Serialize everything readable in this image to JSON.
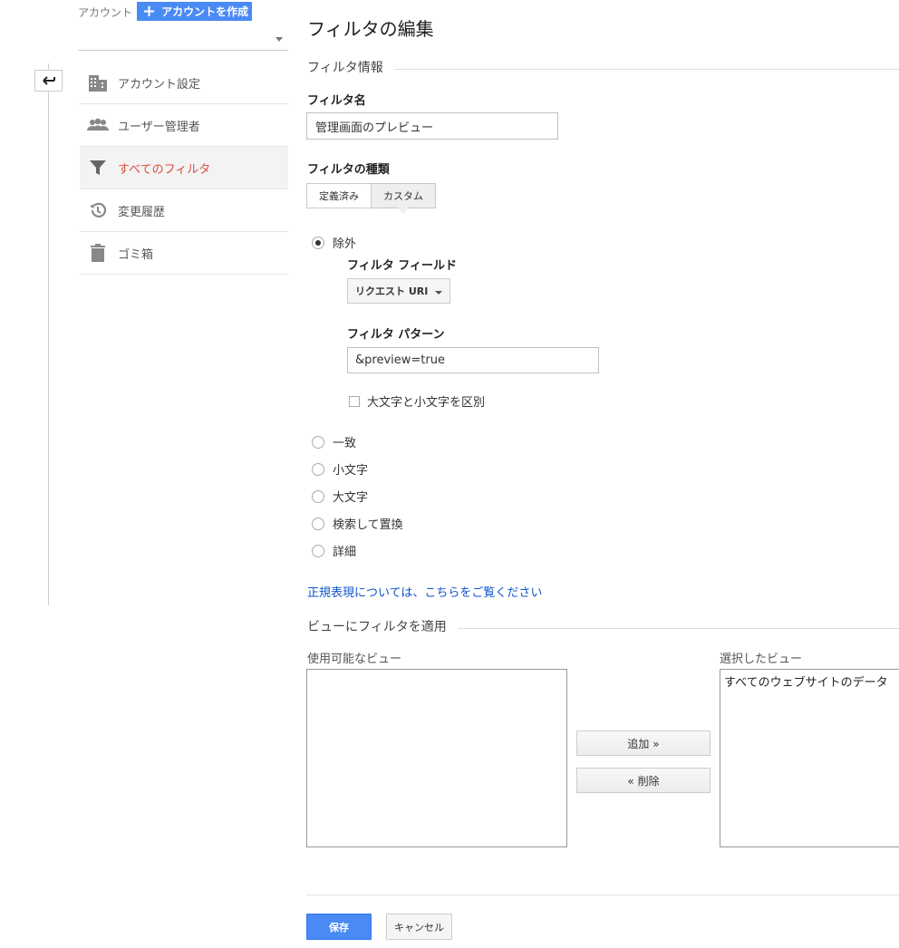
{
  "header": {
    "account_label": "アカウント",
    "create_account_label": "アカウントを作成"
  },
  "sidebar": {
    "items": [
      {
        "label": "アカウント設定",
        "icon": "building-icon"
      },
      {
        "label": "ユーザー管理者",
        "icon": "users-icon"
      },
      {
        "label": "すべてのフィルタ",
        "icon": "filter-icon",
        "active": true
      },
      {
        "label": "変更履歴",
        "icon": "history-icon"
      },
      {
        "label": "ゴミ箱",
        "icon": "trash-icon"
      }
    ]
  },
  "main": {
    "title": "フィルタの編集",
    "filter_info_heading": "フィルタ情報",
    "filter_name_label": "フィルタ名",
    "filter_name_value": "管理画面のプレビュー",
    "filter_type_label": "フィルタの種類",
    "type_tabs": [
      "定義済み",
      "カスタム"
    ],
    "radio_options": [
      "除外",
      "一致",
      "小文字",
      "大文字",
      "検索して置換",
      "詳細"
    ],
    "filter_field_label": "フィルタ フィールド",
    "filter_field_value": "リクエスト URI",
    "filter_pattern_label": "フィルタ パターン",
    "filter_pattern_value": "&preview=true",
    "case_sensitive_label": "大文字と小文字を区別",
    "regex_link": "正規表現については、こちらをご覧ください",
    "apply_heading": "ビューにフィルタを適用",
    "available_views_label": "使用可能なビュー",
    "available_views": [],
    "selected_views_label": "選択したビュー",
    "selected_views": [
      "すべてのウェブサイトのデータ"
    ],
    "add_button": "追加 »",
    "remove_button": "« 削除",
    "save_button": "保存",
    "cancel_button": "キャンセル"
  },
  "colors": {
    "primary_blue": "#4a8af4",
    "active_red": "#dd4b39",
    "link_blue": "#1155cc"
  }
}
